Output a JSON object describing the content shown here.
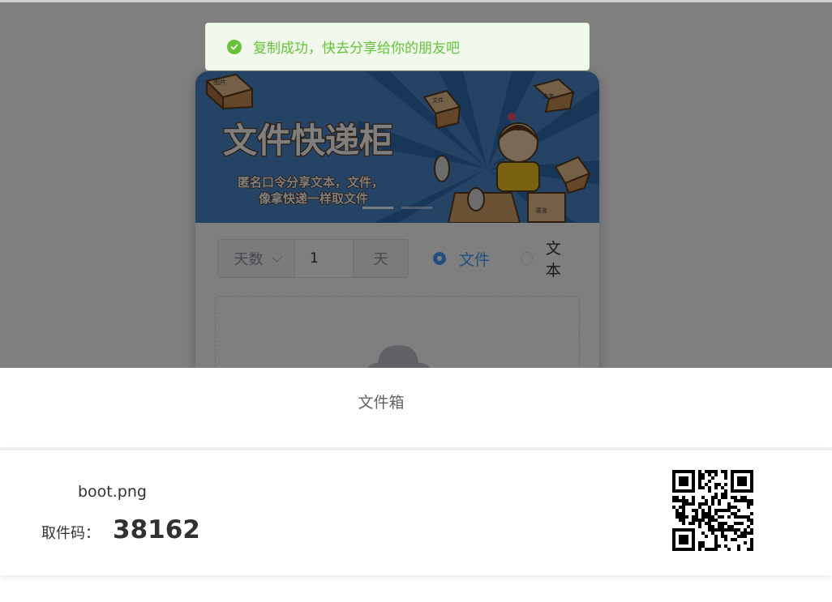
{
  "toast": {
    "message": "复制成功，快去分享给你的朋友吧",
    "icon": "check-circle-icon",
    "color": "#67c23a"
  },
  "banner": {
    "title": "文件快递柜",
    "subtitle_line1": "匿名口令分享文本，文件，",
    "subtitle_line2": "像拿快递一样取文件",
    "box_labels": [
      "图片",
      "文件",
      "文字",
      "匿名"
    ],
    "carousel_indicators": 2
  },
  "controls": {
    "expire_select": "天数",
    "expire_value": "1",
    "expire_unit": "天",
    "radio_options": [
      {
        "label": "文件",
        "checked": true
      },
      {
        "label": "文本",
        "checked": false
      }
    ]
  },
  "drawer": {
    "title": "文件箱",
    "file": {
      "name": "boot.png",
      "code_label": "取件码：",
      "code": "38162"
    }
  },
  "colors": {
    "primary": "#409eff",
    "success": "#67c23a",
    "banner_bg": "#3f7fc4"
  }
}
